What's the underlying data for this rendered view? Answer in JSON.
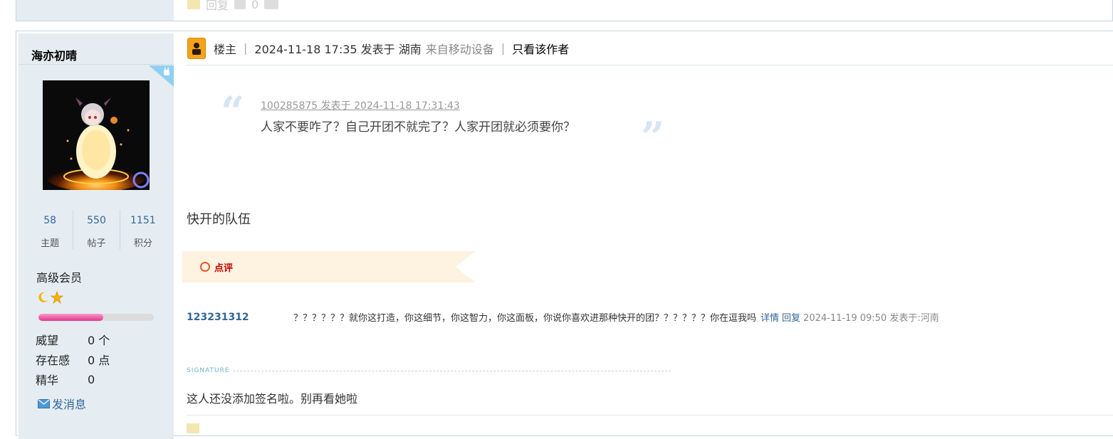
{
  "prev_post": {
    "reply_label": "回复",
    "support_count": "0"
  },
  "author": {
    "name": "海亦初晴",
    "stats": [
      {
        "value": "58",
        "label": "主题"
      },
      {
        "value": "550",
        "label": "帖子"
      },
      {
        "value": "1151",
        "label": "积分"
      }
    ],
    "rank": "高级会员",
    "level_progress": 0.56,
    "info": [
      {
        "label": "威望",
        "value": "0 个"
      },
      {
        "label": "存在感",
        "value": "0 点"
      },
      {
        "label": "精华",
        "value": "0"
      }
    ],
    "pm_label": "发消息"
  },
  "post": {
    "op_label": "楼主",
    "time": "2024-11-18 17:35 发表于 湖南",
    "device": "来自移动设备",
    "only_author": "只看该作者",
    "quote_meta": "100285875 发表于 2024-11-18 17:31:43",
    "quote_text": "人家不要咋了？自己开团不就完了？人家开团就必须要你？",
    "body": "快开的队伍",
    "comment_banner": "点评",
    "comment": {
      "user": "123231312",
      "text": "？？？？？？就你这打造，你这细节，你这智力，你这面板，你说你喜欢进那种快开的团？？？？？？你在逗我吗",
      "detail": "详情",
      "reply": "回复",
      "time": "2024-11-19 09:50 发表于:河南"
    },
    "signature_label": "SIGNATURE",
    "signature": "这人还没添加签名啦。别再看她啦"
  },
  "colors": {
    "link": "#336699",
    "sidebar_bg": "#e5edf2",
    "accent_red": "#c40000"
  }
}
